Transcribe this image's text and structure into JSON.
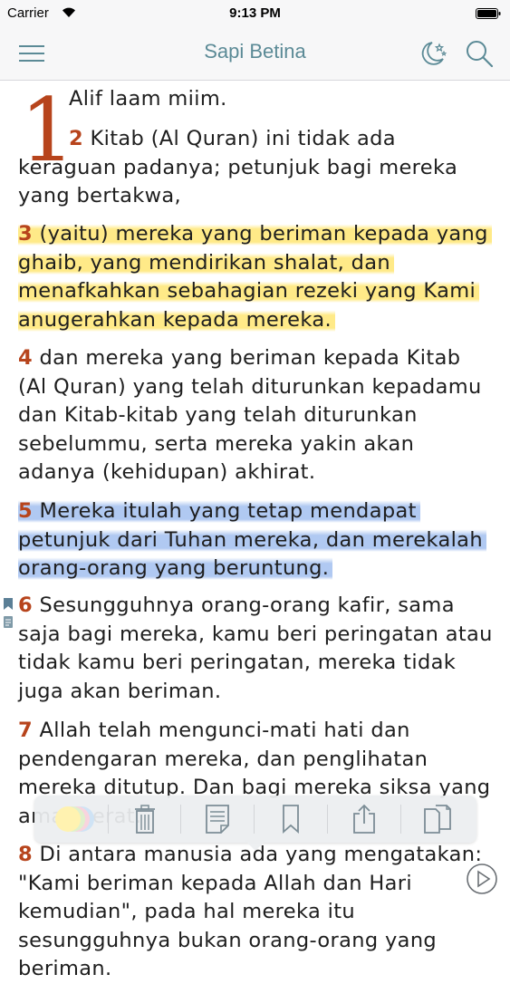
{
  "status_bar": {
    "carrier": "Carrier",
    "time": "9:13 PM"
  },
  "nav": {
    "title": "Sapi Betina"
  },
  "content": {
    "drop_cap": "1",
    "v1": {
      "text": "Alif laam miim."
    },
    "v2": {
      "num": "2",
      "text": " Kitab (Al Quran) ini tidak ada keraguan padanya; petunjuk bagi mereka yang bertakwa,"
    },
    "v3": {
      "num": "3",
      "text": " (yaitu) mereka yang beriman kepada yang ghaib, yang mendirikan shalat, dan menafkahkan sebahagian rezeki yang Kami anugerahkan kepada mereka.",
      "highlight": "#ffe882"
    },
    "v4": {
      "num": "4",
      "text": " dan mereka yang beriman kepada Kitab (Al Quran) yang telah diturunkan kepadamu dan Kitab-kitab yang telah diturunkan sebelummu, serta mereka yakin akan adanya (kehidupan) akhirat."
    },
    "v5": {
      "num": "5",
      "text": " Mereka itulah yang tetap mendapat petunjuk dari Tuhan mereka, dan merekalah orang-orang yang beruntung.",
      "highlight": "#a8c3f0"
    },
    "v6": {
      "num": "6",
      "text": " Sesungguhnya orang-orang kafir, sama saja bagi mereka, kamu beri peringatan atau tidak kamu beri peringatan, mereka tidak juga akan beriman."
    },
    "v7": {
      "num": "7",
      "text": " Allah telah mengunci-mati hati dan pendengaran mereka, dan penglihatan mereka ditutup. Dan bagi mereka siksa yang amat berat."
    },
    "v8": {
      "num": "8",
      "text": " Di antara manusia ada yang mengatakan: \"Kami beriman kepada Allah dan Hari kemudian\", pada hal mereka itu sesungguhnya bukan orang-orang yang beriman."
    }
  },
  "accent_color": "#b7441c",
  "title_color": "#5b8a96",
  "toolbar": {
    "items": [
      "highlight-colors-icon",
      "trash-icon",
      "note-icon",
      "bookmark-icon",
      "share-icon",
      "copy-icon"
    ]
  }
}
